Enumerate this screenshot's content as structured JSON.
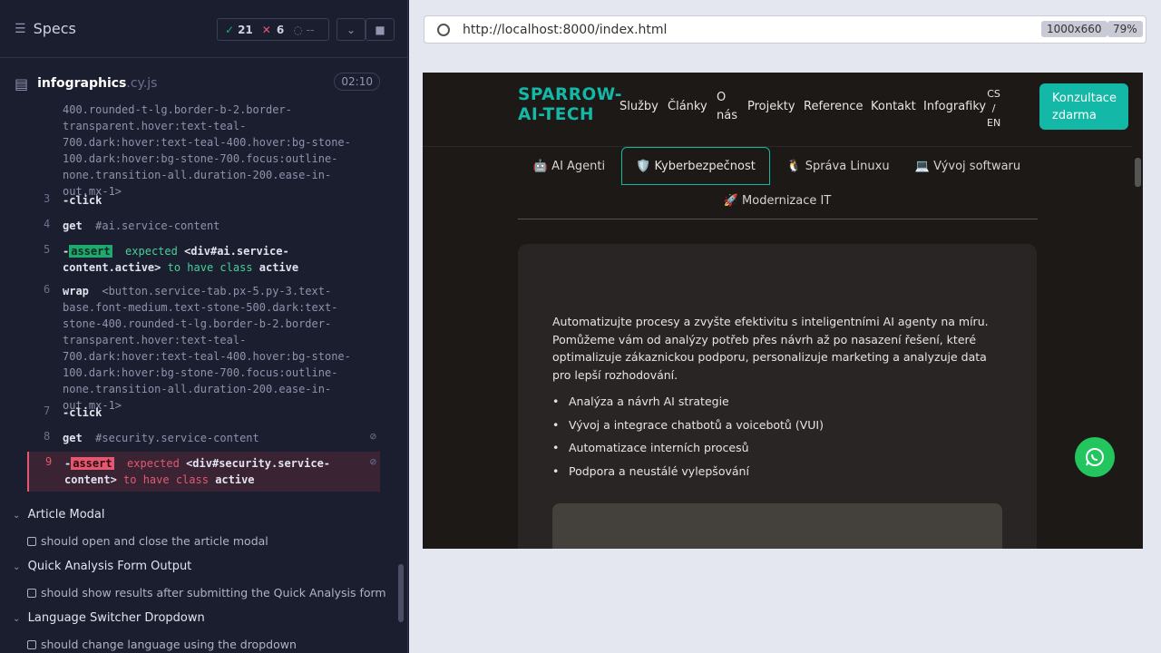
{
  "runner": {
    "title": "Specs",
    "passed": "21",
    "failed": "6",
    "pending": "--",
    "spec_name": "infographics",
    "spec_ext": ".cy.js",
    "duration": "02:10"
  },
  "commands": [
    {
      "num": "",
      "text": "400.rounded-t-lg.border-b-2.border-transparent.hover:text-teal-700.dark:hover:text-teal-400.hover:bg-stone-100.dark:hover:bg-stone-700.focus:outline-none.transition-all.duration-200.ease-in-out.mx-1>"
    },
    {
      "num": "3",
      "cmd": "-click"
    },
    {
      "num": "4",
      "cmd": "get",
      "sel": "#ai.service-content"
    },
    {
      "num": "5",
      "prefix": "-",
      "badge": "assert",
      "expected": "expected",
      "subject": "<div#ai.service-content.active>",
      "tohave": "to have class",
      "cls": "active"
    },
    {
      "num": "6",
      "cmd": "wrap",
      "sel": "<button.service-tab.px-5.py-3.text-base.font-medium.text-stone-500.dark:text-stone-400.rounded-t-lg.border-b-2.border-transparent.hover:text-teal-700.dark:hover:text-teal-400.hover:bg-stone-100.dark:hover:bg-stone-700.focus:outline-none.transition-all.duration-200.ease-in-out.mx-1>"
    },
    {
      "num": "7",
      "cmd": "-click"
    },
    {
      "num": "8",
      "cmd": "get",
      "sel": "#security.service-content"
    },
    {
      "num": "9",
      "prefix": "-",
      "badge": "assert",
      "expected": "expected",
      "subject": "<div#security.service-content>",
      "tohave": "to have class",
      "cls": "active"
    }
  ],
  "suites": [
    {
      "title": "Article Modal",
      "test": "should open and close the article modal"
    },
    {
      "title": "Quick Analysis Form Output",
      "test": "should show results after submitting the Quick Analysis form"
    },
    {
      "title": "Language Switcher Dropdown",
      "test": "should change language using the dropdown"
    }
  ],
  "browser": {
    "url": "http://localhost:8000/index.html",
    "viewport": "1000x660",
    "zoom": "79%"
  },
  "site": {
    "logo_line1": "SPARROW-",
    "logo_line2": "AI-TECH",
    "nav": [
      "Služby",
      "Články",
      "O",
      "nás",
      "Projekty",
      "Reference",
      "Kontakt",
      "Infografiky"
    ],
    "lang": [
      "CS",
      "/",
      "EN"
    ],
    "cta_line1": "Konzultace",
    "cta_line2": "zdarma",
    "tabs": [
      "🤖 AI Agenti",
      "🛡️ Kyberbezpečnost",
      "🐧 Správa Linuxu",
      "💻 Vývoj softwaru",
      "🚀 Modernizace IT"
    ],
    "paragraph": "Automatizujte procesy a zvyšte efektivitu s inteligentními AI agenty na míru. Pomůžeme vám od analýzy potřeb přes návrh až po nasazení řešení, které optimalizuje zákaznickou podporu, personalizuje marketing a analyzuje data pro lepší rozhodování.",
    "bullets": [
      "Analýza a návrh AI strategie",
      "Vývoj a integrace chatbotů a voicebotů (VUI)",
      "Automatizace interních procesů",
      "Podpora a neustálé vylepšování"
    ]
  }
}
